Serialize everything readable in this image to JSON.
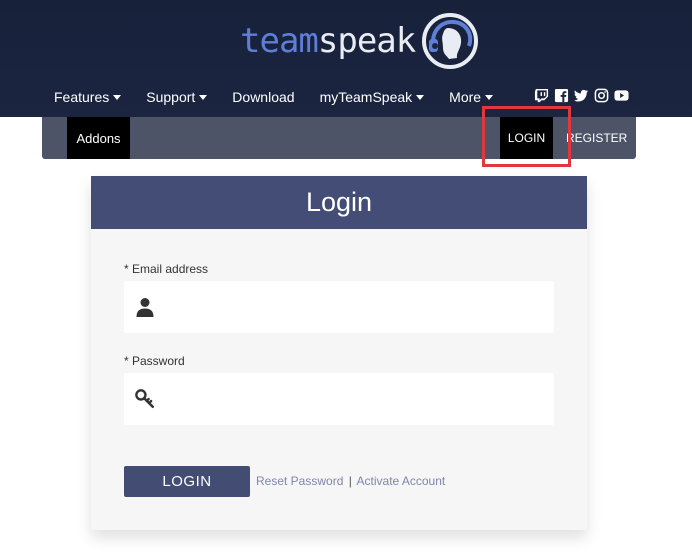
{
  "brand": {
    "logo_team": "team",
    "logo_speak": "speak",
    "colors": {
      "team": "#5f7fd6",
      "speak": "#e9ecf3",
      "header_bg": "#17213a"
    }
  },
  "nav": {
    "items": [
      {
        "label": "Features",
        "has_dropdown": true
      },
      {
        "label": "Support",
        "has_dropdown": true
      },
      {
        "label": "Download",
        "has_dropdown": false
      },
      {
        "label": "myTeamSpeak",
        "has_dropdown": true
      },
      {
        "label": "More",
        "has_dropdown": true
      }
    ],
    "social_icons": [
      "twitch-icon",
      "facebook-icon",
      "twitter-icon",
      "instagram-icon",
      "youtube-icon"
    ]
  },
  "subnav": {
    "addons_label": "Addons",
    "login_label": "LOGIN",
    "register_label": "REGISTER",
    "bar_color": "#4d5467",
    "highlight_color": "#e0383f"
  },
  "login_form": {
    "title": "Login",
    "header_color": "#444d75",
    "email": {
      "label": "* Email address",
      "value": "",
      "placeholder": "",
      "icon": "user-icon"
    },
    "password": {
      "label": "* Password",
      "value": "",
      "placeholder": "",
      "icon": "key-icon"
    },
    "submit_label": "LOGIN",
    "reset_link": "Reset Password",
    "separator": "|",
    "activate_link": "Activate Account"
  }
}
